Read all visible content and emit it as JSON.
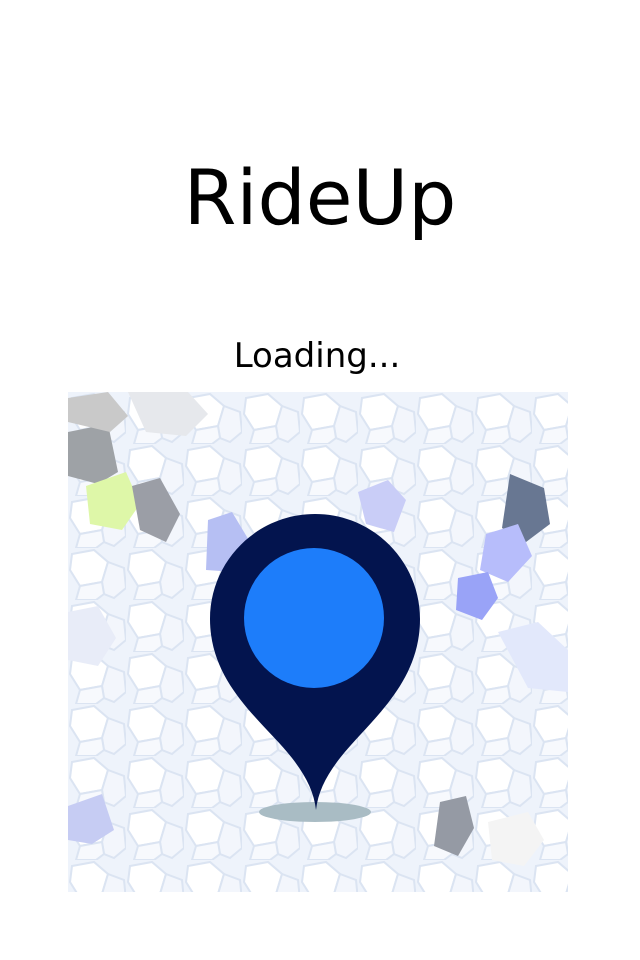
{
  "app": {
    "title": "RideUp",
    "loading_text": "Loading..."
  },
  "splash_image": {
    "icon": "location-pin-icon",
    "background": "mosaic-pattern"
  },
  "colors": {
    "background": "#ffffff",
    "title_text": "#000000",
    "pin_outer": "#03144e",
    "pin_inner": "#1d7dfa",
    "pin_shadow": "#a9bcc4",
    "mosaic_base": "#eef3fb",
    "mosaic_grout": "#dde5f2"
  }
}
